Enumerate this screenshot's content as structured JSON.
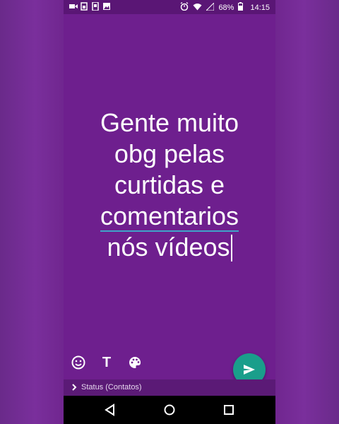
{
  "statusbar": {
    "left_icons": [
      "video-camera-icon",
      "cast-icon",
      "phone-icon",
      "image-icon"
    ],
    "right_icons": [
      "alarm-icon",
      "wifi-icon",
      "signal-icon",
      "battery-icon"
    ],
    "battery_pct": "68%",
    "time": "14:15"
  },
  "status": {
    "lines": [
      "Gente muito",
      "obg pelas",
      "curtidas e",
      "comentarios",
      "nós vídeos"
    ],
    "background_color": "#6e1f8e"
  },
  "toolbar": {
    "emoji_icon": "emoji-icon",
    "text_label": "T",
    "palette_icon": "palette-icon"
  },
  "send": {
    "icon": "send-icon",
    "color": "#1a9e8b"
  },
  "audience": {
    "label": "Status (Contatos)"
  },
  "navbar": {
    "icons": [
      "back-icon",
      "home-icon",
      "recents-icon"
    ]
  }
}
